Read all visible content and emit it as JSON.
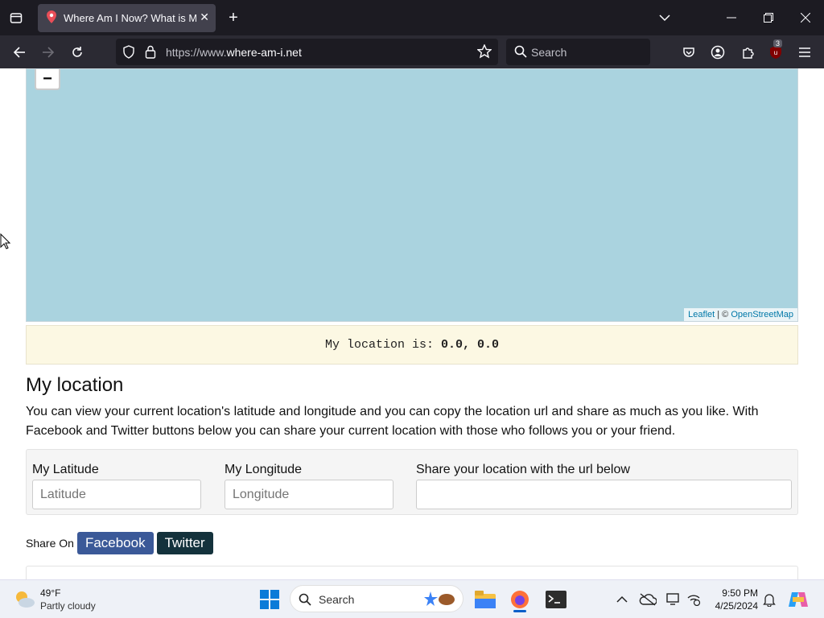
{
  "browser": {
    "tab_title": "Where Am I Now? What is My Location",
    "url_prefix": "https://www.",
    "url_domain": "where-am-i.net",
    "search_placeholder": "Search",
    "extension_badge": "3"
  },
  "map": {
    "zoom_out_label": "−",
    "attribution_leaflet": "Leaflet",
    "attribution_sep": " | © ",
    "attribution_osm": "OpenStreetMap"
  },
  "location": {
    "prefix": "My location is: ",
    "value": "0.0, 0.0"
  },
  "section": {
    "heading": "My location",
    "description": "You can view your current location's latitude and longitude and you can copy the location url and share as much as you like. With Facebook and Twitter buttons below you can share your current location with those who follows you or your friend."
  },
  "form": {
    "latitude_label": "My Latitude",
    "latitude_placeholder": "Latitude",
    "longitude_label": "My Longitude",
    "longitude_placeholder": "Longitude",
    "share_url_label": "Share your location with the url below",
    "share_url_value": ""
  },
  "share": {
    "label": "Share On",
    "facebook": "Facebook",
    "twitter": "Twitter"
  },
  "taskbar": {
    "temperature": "49°F",
    "weather": "Partly cloudy",
    "search": "Search",
    "time": "9:50 PM",
    "date": "4/25/2024"
  }
}
